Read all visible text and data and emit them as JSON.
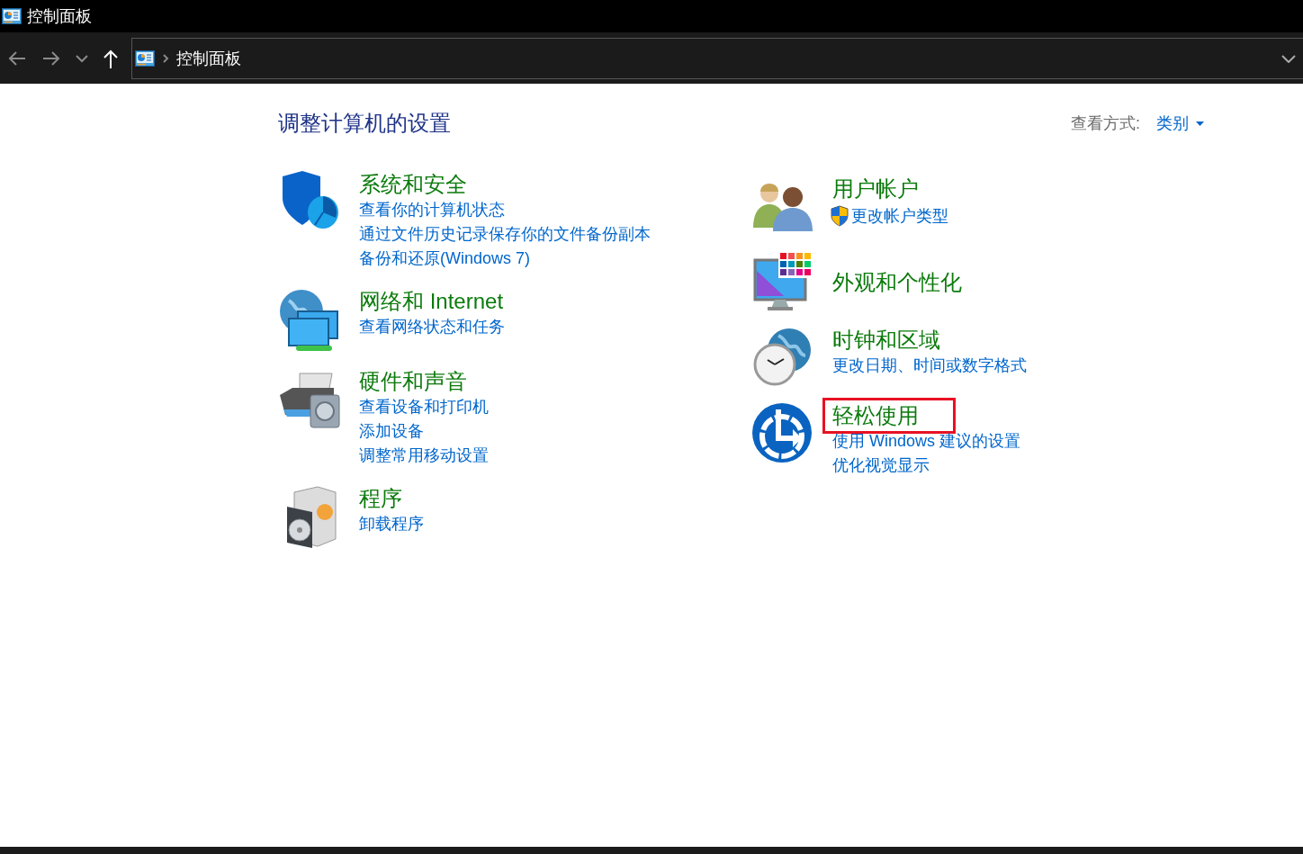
{
  "window": {
    "title": "控制面板"
  },
  "address_bar": {
    "path": [
      "控制面板"
    ]
  },
  "heading": "调整计算机的设置",
  "view_by": {
    "label": "查看方式:",
    "value": "类别"
  },
  "columns": [
    {
      "categories": [
        {
          "kind": "system",
          "title": "系统和安全",
          "highlighted": false,
          "links": [
            {
              "text": "查看你的计算机状态",
              "elevated": false
            },
            {
              "text": "通过文件历史记录保存你的文件备份副本",
              "elevated": false
            },
            {
              "text": "备份和还原(Windows 7)",
              "elevated": false
            }
          ]
        },
        {
          "kind": "network",
          "title": "网络和 Internet",
          "highlighted": false,
          "links": [
            {
              "text": "查看网络状态和任务",
              "elevated": false
            }
          ]
        },
        {
          "kind": "hardware",
          "title": "硬件和声音",
          "highlighted": false,
          "links": [
            {
              "text": "查看设备和打印机",
              "elevated": false
            },
            {
              "text": "添加设备",
              "elevated": false
            },
            {
              "text": "调整常用移动设置",
              "elevated": false
            }
          ]
        },
        {
          "kind": "programs",
          "title": "程序",
          "highlighted": false,
          "links": [
            {
              "text": "卸载程序",
              "elevated": false
            }
          ]
        }
      ]
    },
    {
      "categories": [
        {
          "kind": "accounts",
          "title": "用户帐户",
          "highlighted": false,
          "links": [
            {
              "text": "更改帐户类型",
              "elevated": true
            }
          ]
        },
        {
          "kind": "appearance",
          "title": "外观和个性化",
          "highlighted": false
        },
        {
          "kind": "clock",
          "title": "时钟和区域",
          "highlighted": false,
          "links": [
            {
              "text": "更改日期、时间或数字格式",
              "elevated": false
            }
          ]
        },
        {
          "kind": "access",
          "title": "轻松使用",
          "highlighted": true,
          "links": [
            {
              "text": "使用 Windows 建议的设置",
              "elevated": false
            },
            {
              "text": "优化视觉显示",
              "elevated": false
            }
          ]
        }
      ]
    }
  ]
}
